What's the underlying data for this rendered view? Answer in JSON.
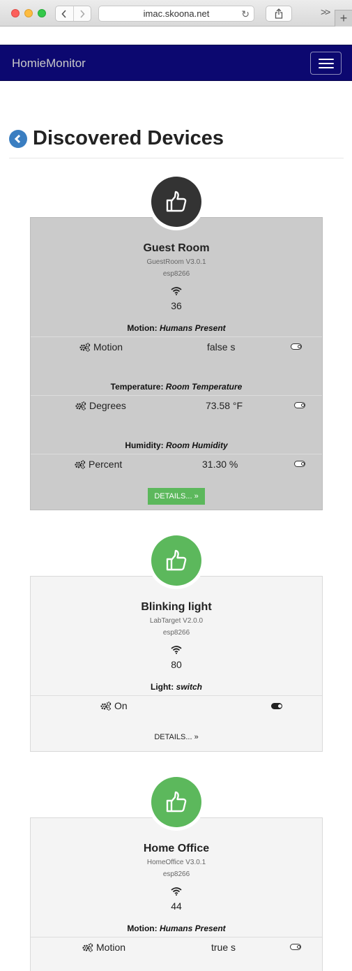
{
  "browser": {
    "url": "imac.skoona.net",
    "more": ">>",
    "new_tab": "+"
  },
  "navbar": {
    "brand": "HomieMonitor"
  },
  "page": {
    "title": "Discovered Devices"
  },
  "devices": [
    {
      "name": "Guest Room",
      "firmware": "GuestRoom V3.0.1",
      "platform": "esp8266",
      "signal": "36",
      "status_color": "#333333",
      "details_label": "DETAILS... »",
      "nodes": [
        {
          "label": "Motion:",
          "type": "Humans Present",
          "property": "Motion",
          "value": "false s"
        },
        {
          "label": "Temperature:",
          "type": "Room Temperature",
          "property": "Degrees",
          "value": "73.58 °F"
        },
        {
          "label": "Humidity:",
          "type": "Room Humidity",
          "property": "Percent",
          "value": "31.30 %"
        }
      ]
    },
    {
      "name": "Blinking light",
      "firmware": "LabTarget V2.0.0",
      "platform": "esp8266",
      "signal": "80",
      "status_color": "#5cb85c",
      "details_label": "DETAILS... »",
      "nodes": [
        {
          "label": "Light:",
          "type": "switch",
          "property": "On",
          "value": ""
        }
      ]
    },
    {
      "name": "Home Office",
      "firmware": "HomeOffice V3.0.1",
      "platform": "esp8266",
      "signal": "44",
      "status_color": "#5cb85c",
      "nodes": [
        {
          "label": "Motion:",
          "type": "Humans Present",
          "property": "Motion",
          "value": "true s"
        }
      ]
    }
  ],
  "icons": {
    "status": "thumbs-up-icon",
    "wifi": "wifi-icon",
    "property": "cogs-icon",
    "toggle": "toggle-icon",
    "back": "back-circle-icon"
  }
}
